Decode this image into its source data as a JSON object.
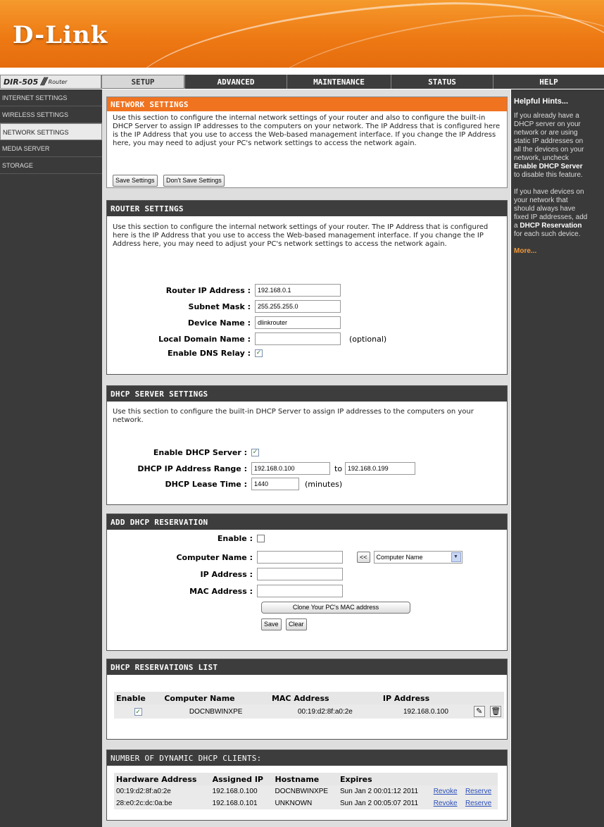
{
  "brand": {
    "logo": "D-Link",
    "model": "DIR-505",
    "model_suffix": "Router"
  },
  "nav": {
    "tabs": [
      "SETUP",
      "ADVANCED",
      "MAINTENANCE",
      "STATUS",
      "HELP"
    ],
    "active": "SETUP"
  },
  "sidebar": {
    "items": [
      "INTERNET SETTINGS",
      "WIRELESS SETTINGS",
      "NETWORK SETTINGS",
      "MEDIA SERVER",
      "STORAGE"
    ],
    "active": "NETWORK SETTINGS"
  },
  "network": {
    "title": "NETWORK SETTINGS",
    "desc": "Use this section to configure the internal network settings of your router and also to configure the built-in DHCP Server to assign IP addresses to the computers on your network. The IP Address that is configured here is the IP Address that you use to access the Web-based management interface. If you change the IP Address here, you may need to adjust your PC's network settings to access the network again.",
    "save_label": "Save Settings",
    "dont_save_label": "Don't Save Settings"
  },
  "router": {
    "title": "ROUTER SETTINGS",
    "desc": "Use this section to configure the internal network settings of your router. The IP Address that is configured here is the IP Address that you use to access the Web-based management interface. If you change the IP Address here, you may need to adjust your PC's network settings to access the network again.",
    "ip_label": "Router IP Address :",
    "ip_value": "192.168.0.1",
    "mask_label": "Subnet Mask :",
    "mask_value": "255.255.255.0",
    "device_label": "Device Name :",
    "device_value": "dlinkrouter",
    "domain_label": "Local Domain Name :",
    "domain_value": "",
    "domain_hint": "(optional)",
    "dns_label": "Enable DNS Relay :",
    "dns_checked": true
  },
  "dhcp": {
    "title": "DHCP SERVER SETTINGS",
    "desc": "Use this section to configure the built-in DHCP Server to assign IP addresses to the computers on your network.",
    "enable_label": "Enable DHCP Server :",
    "enable_checked": true,
    "range_label": "DHCP IP Address Range :",
    "range_start": "192.168.0.100",
    "range_to": "to",
    "range_end": "192.168.0.199",
    "lease_label": "DHCP Lease Time :",
    "lease_value": "1440",
    "lease_unit": "(minutes)"
  },
  "reservation": {
    "title": "ADD DHCP RESERVATION",
    "enable_label": "Enable :",
    "computer_label": "Computer Name :",
    "computer_value": "",
    "copy_button": "<<",
    "select_value": "Computer Name",
    "ip_label": "IP Address :",
    "ip_value": "",
    "mac_label": "MAC Address :",
    "mac_value": "",
    "clone_button": "Clone Your PC's MAC address",
    "save_button": "Save",
    "clear_button": "Clear"
  },
  "res_list": {
    "title": "DHCP RESERVATIONS LIST",
    "headers": [
      "Enable",
      "Computer Name",
      "MAC Address",
      "IP Address"
    ],
    "rows": [
      {
        "enabled": true,
        "name": "DOCNBWINXPE",
        "mac": "00:19:d2:8f:a0:2e",
        "ip": "192.168.0.100",
        "edit_icon": "edit-icon",
        "delete_icon": "trash-icon"
      }
    ]
  },
  "clients": {
    "title": "NUMBER OF DYNAMIC DHCP CLIENTS:",
    "headers": [
      "Hardware Address",
      "Assigned IP",
      "Hostname",
      "Expires"
    ],
    "rows": [
      {
        "mac": "00:19:d2:8f:a0:2e",
        "ip": "192.168.0.100",
        "host": "DOCNBWINXPE",
        "expires": "Sun Jan 2 00:01:12 2011",
        "revoke": "Revoke",
        "reserve": "Reserve"
      },
      {
        "mac": "28:e0:2c:dc:0a:be",
        "ip": "192.168.0.101",
        "host": "UNKNOWN",
        "expires": "Sun Jan 2 00:05:07 2011",
        "revoke": "Revoke",
        "reserve": "Reserve"
      }
    ]
  },
  "help": {
    "title": "Helpful Hints...",
    "hint1_lines": [
      "If you already have a",
      "DHCP server on your",
      "network or are using",
      "static IP addresses on",
      "all the devices on your",
      "network, uncheck"
    ],
    "hint1_bold": "Enable DHCP Server",
    "hint1_tail": "to disable this feature.",
    "hint2_lines": [
      "If you have devices on",
      "your network that",
      "should always have",
      "fixed IP addresses, add",
      "a"
    ],
    "hint2_bold": "DHCP Reservation",
    "hint2_tail": "for each such device.",
    "more": "More..."
  }
}
